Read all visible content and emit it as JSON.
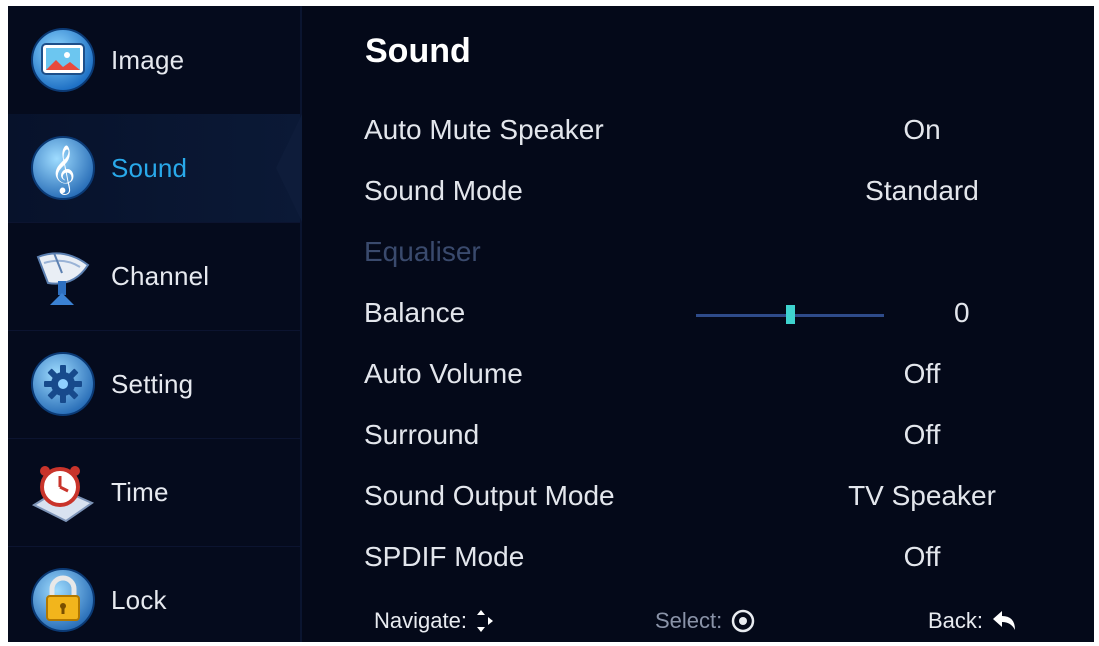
{
  "sidebar": {
    "items": [
      {
        "label": "Image",
        "icon": "image-icon"
      },
      {
        "label": "Sound",
        "icon": "music-clef-icon"
      },
      {
        "label": "Channel",
        "icon": "satellite-dish-icon"
      },
      {
        "label": "Setting",
        "icon": "gear-icon"
      },
      {
        "label": "Time",
        "icon": "alarm-clock-icon"
      },
      {
        "label": "Lock",
        "icon": "padlock-icon"
      }
    ],
    "active_index": 1
  },
  "panel": {
    "title": "Sound",
    "rows": [
      {
        "label": "Auto Mute Speaker",
        "value": "On"
      },
      {
        "label": "Sound Mode",
        "value": "Standard"
      },
      {
        "label": "Equaliser",
        "value": ""
      },
      {
        "label": "Balance",
        "value": "0"
      },
      {
        "label": "Auto Volume",
        "value": "Off"
      },
      {
        "label": "Surround",
        "value": "Off"
      },
      {
        "label": "Sound Output Mode",
        "value": "TV Speaker"
      },
      {
        "label": "SPDIF Mode",
        "value": "Off"
      }
    ],
    "balance_slider_fraction": 0.5
  },
  "footer": {
    "navigate": "Navigate:",
    "select": "Select:",
    "back": "Back:"
  },
  "colors": {
    "background": "#040919",
    "active_label": "#29a9ea",
    "slider_thumb": "#3ed3cf",
    "disabled_label": "#3a4a6d"
  }
}
